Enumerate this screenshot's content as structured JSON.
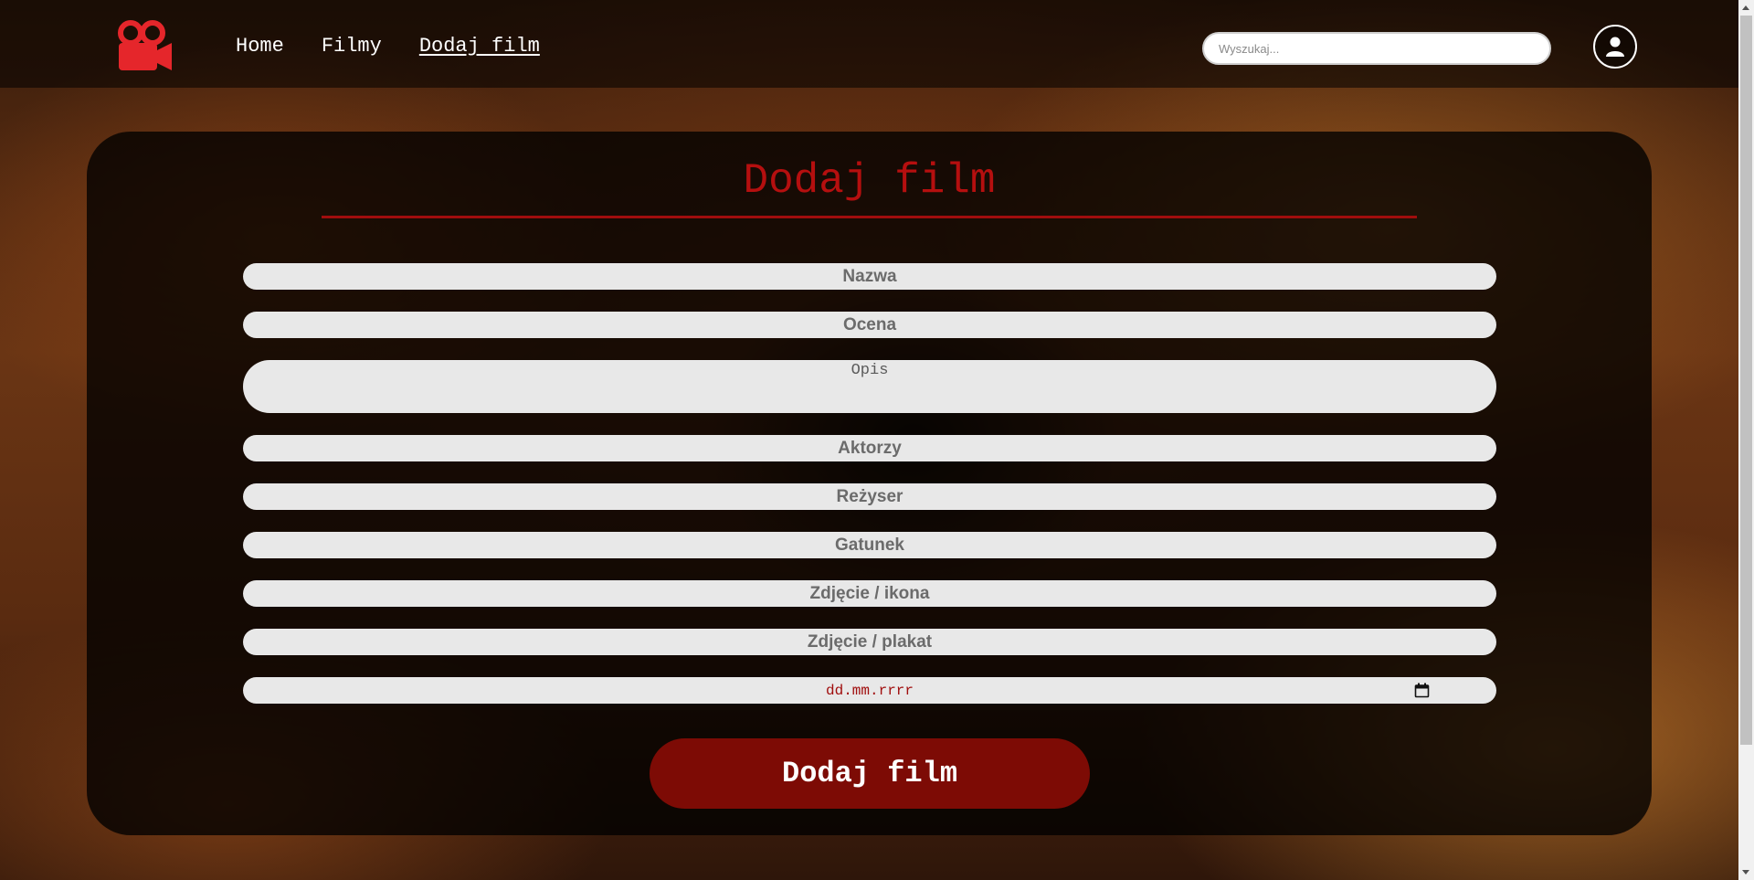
{
  "nav": {
    "logo_icon": "film-camera-icon",
    "links": [
      {
        "label": "Home"
      },
      {
        "label": "Filmy"
      },
      {
        "label": "Dodaj film"
      }
    ],
    "search_placeholder": "Wyszukaj...",
    "profile_icon": "user-icon"
  },
  "form": {
    "title": "Dodaj film",
    "fields": {
      "name_placeholder": "Nazwa",
      "rating_placeholder": "Ocena",
      "description_placeholder": "Opis",
      "actors_placeholder": "Aktorzy",
      "director_placeholder": "Reżyser",
      "genre_placeholder": "Gatunek",
      "icon_image_placeholder": "Zdjęcie / ikona",
      "poster_image_placeholder": "Zdjęcie / plakat",
      "date_placeholder": "dd.mm.rrrr"
    },
    "submit_label": "Dodaj film"
  },
  "colors": {
    "accent_red": "#b50f0f",
    "button_red": "#7d0b05",
    "logo_red": "#e5262b"
  }
}
